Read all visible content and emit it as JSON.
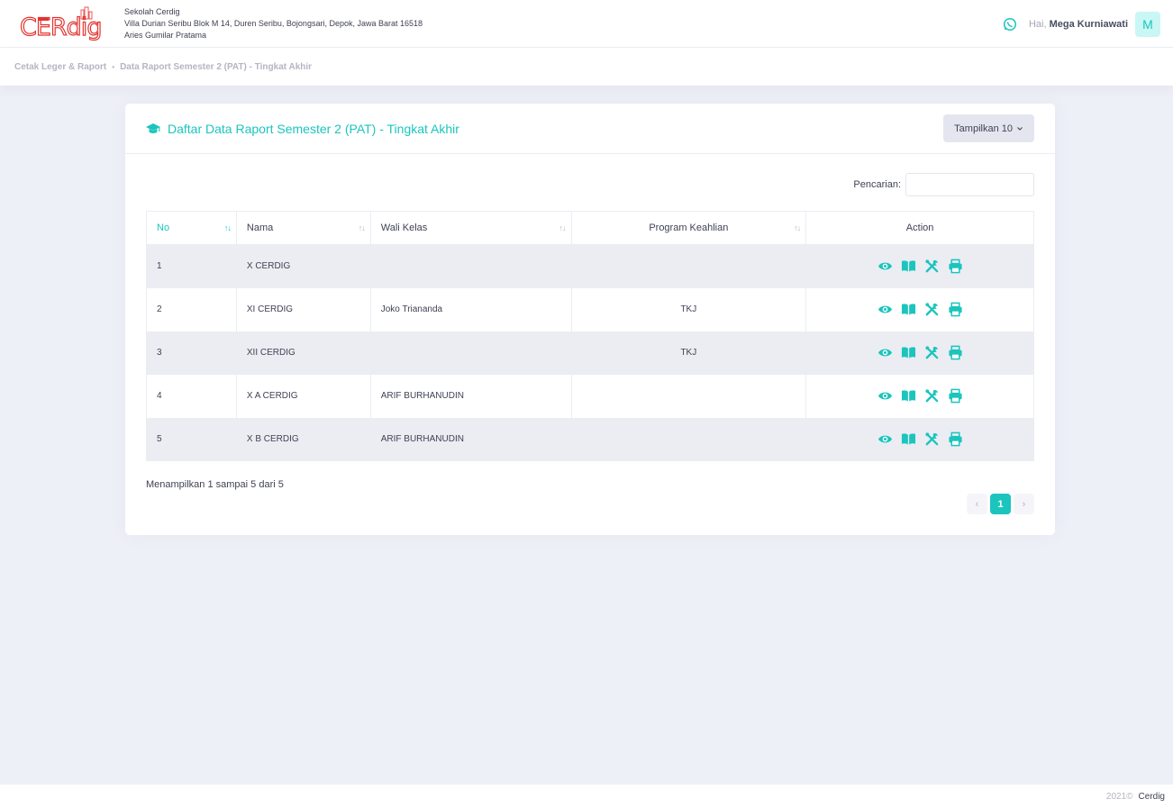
{
  "header": {
    "logo_text": "CERdig",
    "school_name": "Sekolah Cerdig",
    "address": "Villa Durian Seribu Blok M 14, Duren Seribu, Bojongsari, Depok, Jawa Barat 16518",
    "principal": "Aries Gumilar Pratama",
    "greeting": "Hai,",
    "user_name": "Mega Kurniawati",
    "avatar_initial": "M"
  },
  "breadcrumb": {
    "items": [
      "Cetak Leger & Raport",
      "Data Raport Semester 2 (PAT) - Tingkat Akhir"
    ]
  },
  "card": {
    "title": "Daftar Data Raport Semester 2 (PAT) - Tingkat Akhir",
    "show_button": "Tampilkan 10"
  },
  "search": {
    "label": "Pencarian:",
    "value": ""
  },
  "table": {
    "columns": [
      "No",
      "Nama",
      "Wali Kelas",
      "Program Keahlian",
      "Action"
    ],
    "rows": [
      {
        "no": "1",
        "nama": "X CERDIG",
        "wali": "",
        "program": ""
      },
      {
        "no": "2",
        "nama": "XI CERDIG",
        "wali": "Joko Triananda",
        "program": "TKJ"
      },
      {
        "no": "3",
        "nama": "XII CERDIG",
        "wali": "",
        "program": "TKJ"
      },
      {
        "no": "4",
        "nama": "X A CERDIG",
        "wali": "ARIF BURHANUDIN",
        "program": ""
      },
      {
        "no": "5",
        "nama": "X B CERDIG",
        "wali": "ARIF BURHANUDIN",
        "program": ""
      }
    ],
    "action_icons": [
      "eye-icon",
      "book-icon",
      "tools-icon",
      "print-icon"
    ]
  },
  "info": "Menampilkan 1 sampai 5 dari 5",
  "pagination": {
    "prev": "‹",
    "current": "1",
    "next": "›"
  },
  "footer": {
    "year": "2021©",
    "brand": "Cerdig"
  },
  "colors": {
    "accent": "#1bc5bd",
    "logo_red": "#e3342f",
    "bg": "#eef0f8",
    "row_stripe": "#ebedf3"
  }
}
